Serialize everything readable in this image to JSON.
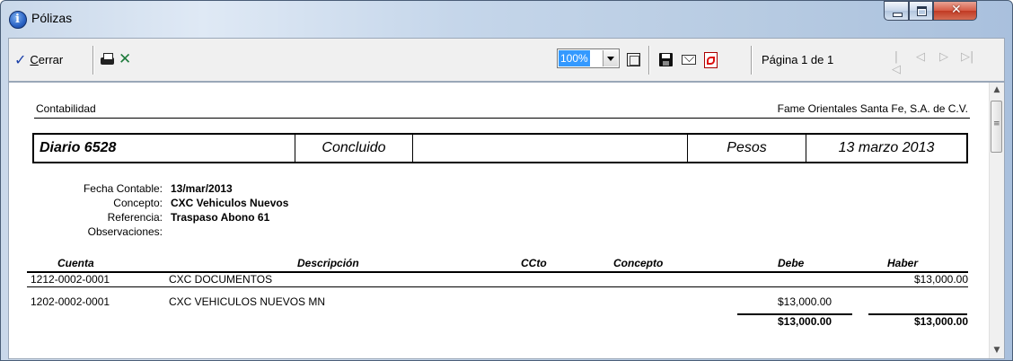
{
  "window": {
    "title": "Pólizas"
  },
  "toolbar": {
    "close_label_prefix": "C",
    "close_label_rest": "errar",
    "zoom_value": "100%",
    "page_label": "Página 1 de 1"
  },
  "document": {
    "header_left": "Contabilidad",
    "header_right": "Fame Orientales Santa Fe, S.A. de C.V.",
    "journal": {
      "name": "Diario  6528",
      "status": "Concluido",
      "blank": "",
      "currency": "Pesos",
      "date": "13 marzo 2013"
    },
    "meta": [
      {
        "label": "Fecha Contable:",
        "value": "13/mar/2013"
      },
      {
        "label": "Concepto:",
        "value": "CXC Vehiculos Nuevos"
      },
      {
        "label": "Referencia:",
        "value": "Traspaso Abono 61"
      },
      {
        "label": "Observaciones:",
        "value": ""
      }
    ],
    "columns": [
      "Cuenta",
      "Descripción",
      "CCto",
      "Concepto",
      "Debe",
      "Haber"
    ],
    "rows": [
      {
        "cuenta": "1212-0002-0001",
        "descripcion": "CXC DOCUMENTOS",
        "debe": "",
        "haber": "$13,000.00"
      },
      {
        "cuenta": "1202-0002-0001",
        "descripcion": "CXC VEHICULOS NUEVOS MN",
        "debe": "$13,000.00",
        "haber": ""
      }
    ],
    "totals": {
      "debe": "$13,000.00",
      "haber": "$13,000.00"
    }
  }
}
